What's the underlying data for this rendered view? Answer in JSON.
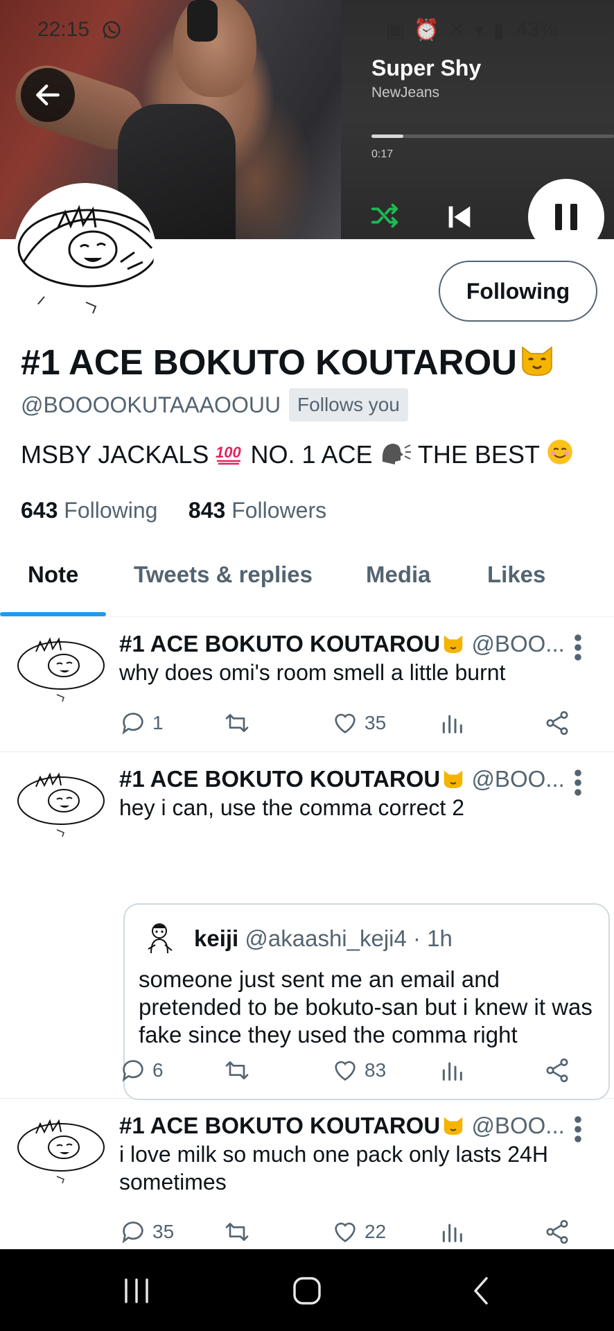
{
  "status_bar": {
    "time": "22:15",
    "battery": "43%"
  },
  "music": {
    "title": "Super Shy",
    "artist": "NewJeans",
    "elapsed": "0:17",
    "progress": 0.13
  },
  "profile": {
    "display_name": "#1 ACE BOKUTO KOUTAROU",
    "handle": "@BOOOOKUTAAAOOUU",
    "follows_you": "Follows you",
    "follow_button": "Following",
    "bio_part1": "MSBY JACKALS",
    "bio_part2": "NO. 1 ACE",
    "bio_part3": "THE BEST",
    "following_count": "643",
    "following_label": "Following",
    "followers_count": "843",
    "followers_label": "Followers"
  },
  "tabs": [
    {
      "label": "Note"
    },
    {
      "label": "Tweets & replies"
    },
    {
      "label": "Media"
    },
    {
      "label": "Likes"
    }
  ],
  "tweets": [
    {
      "name": "#1 ACE BOKUTO KOUTAROU",
      "handle": "@BOO...",
      "text": "why does omi's room smell a little burnt",
      "replies": "1",
      "retweets": "",
      "likes": "35"
    },
    {
      "name": "#1 ACE BOKUTO KOUTAROU",
      "handle": "@BOO...",
      "text": "hey i can, use the comma correct 2",
      "quote": {
        "name": "keiji",
        "handle": "@akaashi_keji4 · 1h",
        "text": "someone just sent me an email and pretended to be bokuto-san but i knew it was fake since they used the comma right"
      },
      "replies": "6",
      "retweets": "",
      "likes": "83"
    },
    {
      "name": "#1 ACE BOKUTO KOUTAROU",
      "handle": "@BOO...",
      "text": "i love milk so much one pack only lasts 24H sometimes",
      "replies": "35",
      "retweets": "",
      "likes": "22"
    }
  ],
  "colors": {
    "accent": "#1d9bf0",
    "secondary_text": "#536471",
    "spotify_green": "#1db954"
  }
}
